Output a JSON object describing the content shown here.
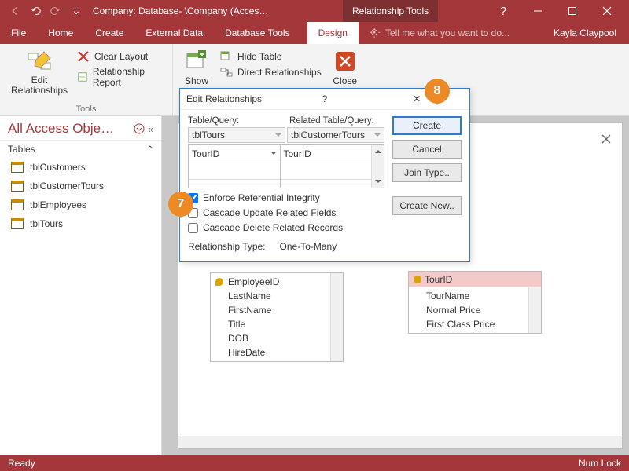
{
  "titlebar": {
    "app_title": "Company: Database- \\Company (Acces…",
    "context_tab": "Relationship Tools"
  },
  "window_controls": {
    "help": "?",
    "user": "Kayla Claypool"
  },
  "tabs": {
    "file": "File",
    "home": "Home",
    "create": "Create",
    "external": "External Data",
    "dbtools": "Database Tools",
    "design": "Design",
    "tellme": "Tell me what you want to do..."
  },
  "ribbon": {
    "edit_rel": "Edit\nRelationships",
    "clear_layout": "Clear Layout",
    "rel_report": "Relationship Report",
    "tools_group": "Tools",
    "show": "Show",
    "hide_table": "Hide Table",
    "direct_rel": "Direct Relationships",
    "close": "Close"
  },
  "nav": {
    "header": "All Access Obje…",
    "section": "Tables",
    "items": [
      "tblCustomers",
      "tblCustomerTours",
      "tblEmployees",
      "tblTours"
    ]
  },
  "dialog": {
    "title": "Edit Relationships",
    "lbl_table": "Table/Query:",
    "lbl_related": "Related Table/Query:",
    "cmb_left": "tblTours",
    "cmb_right": "tblCustomerTours",
    "field_left": "TourID",
    "field_right": "TourID",
    "chk_enforce": "Enforce Referential Integrity",
    "chk_cascade_upd": "Cascade Update Related Fields",
    "chk_cascade_del": "Cascade Delete Related Records",
    "rel_type_lbl": "Relationship Type:",
    "rel_type_val": "One-To-Many",
    "btn_create": "Create",
    "btn_cancel": "Cancel",
    "btn_join": "Join Type..",
    "btn_new": "Create New.."
  },
  "table_windows": {
    "emp_fields": [
      "EmployeeID",
      "LastName",
      "FirstName",
      "Title",
      "DOB",
      "HireDate"
    ],
    "tour_header": "TourID",
    "tour_fields": [
      "TourName",
      "Normal Price",
      "First Class Price"
    ]
  },
  "callouts": {
    "c7": "7",
    "c8": "8"
  },
  "status": {
    "ready": "Ready",
    "numlock": "Num Lock"
  }
}
